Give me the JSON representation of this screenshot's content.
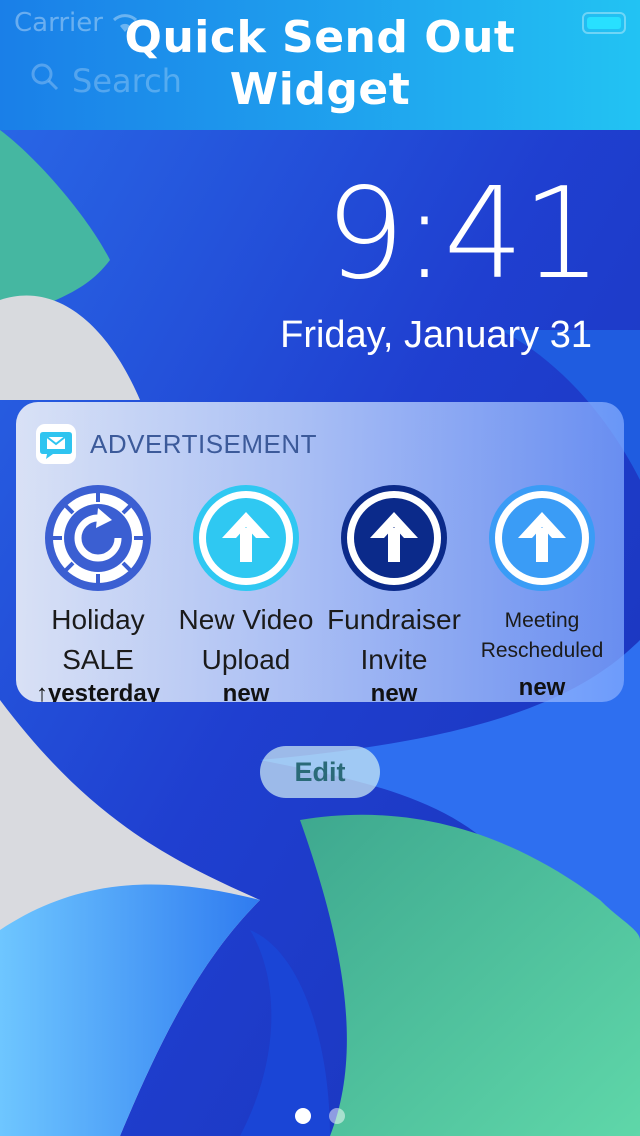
{
  "banner": {
    "title_line1": "Quick Send Out",
    "title_line2": "Widget",
    "carrier": "Carrier",
    "search_placeholder": "Search",
    "gradient": [
      "#1a7fe8",
      "#22c3f3"
    ]
  },
  "lockscreen": {
    "time": "9:41",
    "date": "Friday, January 31"
  },
  "widget": {
    "label": "ADVERTISEMENT",
    "items": [
      {
        "line1": "Holiday",
        "line2": "SALE",
        "status": "↑yesterday",
        "icon": "refresh-dial-icon"
      },
      {
        "line1": "New Video",
        "line2": "Upload",
        "status": "new",
        "icon": "upload-arrow-icon"
      },
      {
        "line1": "Fundraiser",
        "line2": "Invite",
        "status": "new",
        "icon": "upload-arrow-icon"
      },
      {
        "line1": "Meeting",
        "line2": "Rescheduled",
        "status": "new",
        "icon": "upload-arrow-icon"
      }
    ]
  },
  "edit_label": "Edit",
  "page_dots": {
    "count": 2,
    "active": 0
  },
  "colors": {
    "accent_cyan": "#28e0ff",
    "dark_navy": "#0b2a8a",
    "widget_label": "#3c5a9a"
  }
}
